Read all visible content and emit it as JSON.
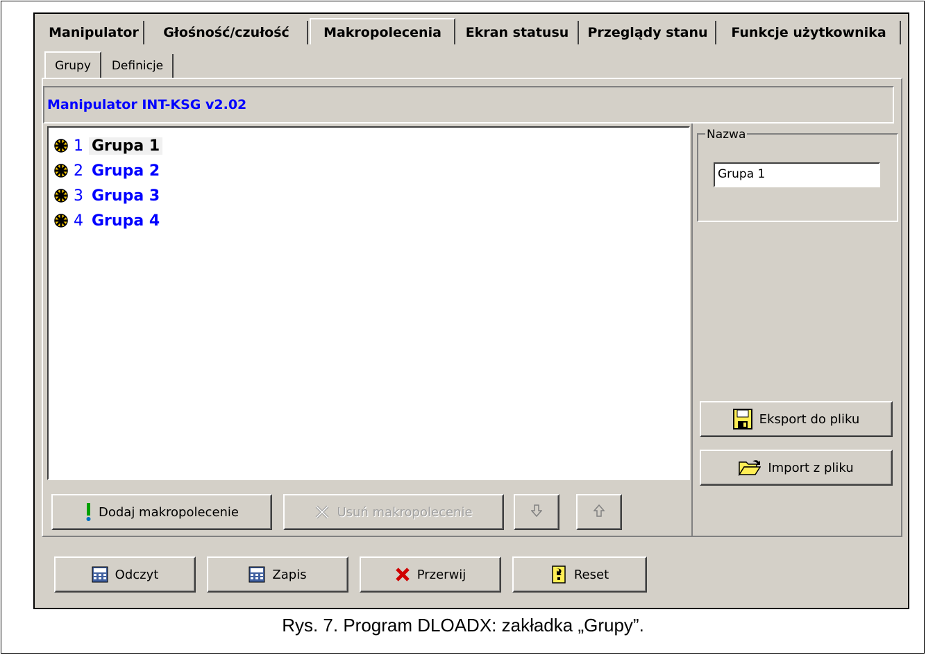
{
  "main_tabs": [
    "Manipulator",
    "Głośność/czułość",
    "Makropolecenia",
    "Ekran statusu",
    "Przeglądy stanu",
    "Funkcje użytkownika"
  ],
  "sub_tabs": [
    "Grupy",
    "Definicje"
  ],
  "header": "Manipulator INT-KSG v2.02",
  "groups": [
    {
      "num": "1",
      "name": "Grupa 1"
    },
    {
      "num": "2",
      "name": "Grupa 2"
    },
    {
      "num": "3",
      "name": "Grupa 3"
    },
    {
      "num": "4",
      "name": "Grupa 4"
    }
  ],
  "name_box": {
    "label": "Nazwa",
    "value": "Grupa 1"
  },
  "buttons": {
    "export": "Eksport do pliku",
    "import": "Import z pliku",
    "add_macro": "Dodaj makropolecenie",
    "remove_macro": "Usuń makropolecenie",
    "read": "Odczyt",
    "write": "Zapis",
    "abort": "Przerwij",
    "reset": "Reset"
  },
  "caption": "Rys. 7. Program DLOADX: zakładka „Grupy”."
}
